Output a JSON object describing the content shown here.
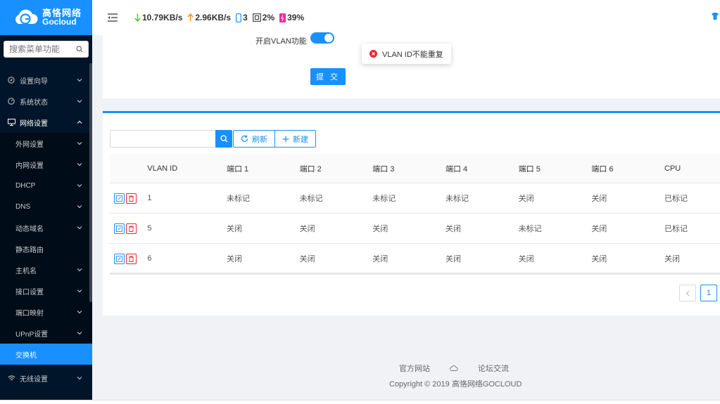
{
  "brand": {
    "name_cn": "高恪网络",
    "name_en": "Gocloud"
  },
  "sidebar": {
    "search_placeholder": "搜索菜单功能",
    "items": [
      {
        "label": "设置向导",
        "icon": "compass-icon"
      },
      {
        "label": "系统状态",
        "icon": "dashboard-icon"
      },
      {
        "label": "网络设置",
        "icon": "monitor-icon"
      }
    ],
    "sub_items": [
      {
        "label": "外网设置"
      },
      {
        "label": "内网设置"
      },
      {
        "label": "DHCP"
      },
      {
        "label": "DNS"
      },
      {
        "label": "动态域名"
      },
      {
        "label": "静态路由"
      },
      {
        "label": "主机名"
      },
      {
        "label": "接口设置"
      },
      {
        "label": "端口映射"
      },
      {
        "label": "UPnP设置"
      },
      {
        "label": "交换机"
      }
    ],
    "wireless": {
      "label": "无线设置",
      "icon": "wifi-icon"
    }
  },
  "topbar": {
    "download": "10.79KB/s",
    "upload": "2.96KB/s",
    "devices": "3",
    "cpu": "2%",
    "memory": "39%"
  },
  "form": {
    "vlan_switch_label": "开启VLAN功能",
    "vlan_switch_on": true,
    "submit_label": "提 交"
  },
  "toast": {
    "message": "VLAN ID不能重复",
    "color": "#f5222d"
  },
  "toolbar": {
    "search_placeholder": "",
    "refresh_label": "刷新",
    "new_label": "新建"
  },
  "table": {
    "headers": [
      "VLAN ID",
      "端口 1",
      "端口 2",
      "端口 3",
      "端口 4",
      "端口 5",
      "端口 6",
      "CPU"
    ],
    "rows": [
      [
        "1",
        "未标记",
        "未标记",
        "未标记",
        "未标记",
        "关闭",
        "关闭",
        "已标记"
      ],
      [
        "5",
        "关闭",
        "关闭",
        "关闭",
        "关闭",
        "未标记",
        "关闭",
        "已标记"
      ],
      [
        "6",
        "关闭",
        "关闭",
        "关闭",
        "关闭",
        "关闭",
        "关闭",
        "关闭"
      ]
    ]
  },
  "pagination": {
    "current": "1"
  },
  "footer": {
    "link_official": "官方网站",
    "link_forum": "论坛交流",
    "copyright": "Copyright © 2019 高恪网络GOCLOUD"
  },
  "colors": {
    "accent": "#1890ff",
    "sidebar_bg": "#001529",
    "danger": "#f5222d"
  }
}
